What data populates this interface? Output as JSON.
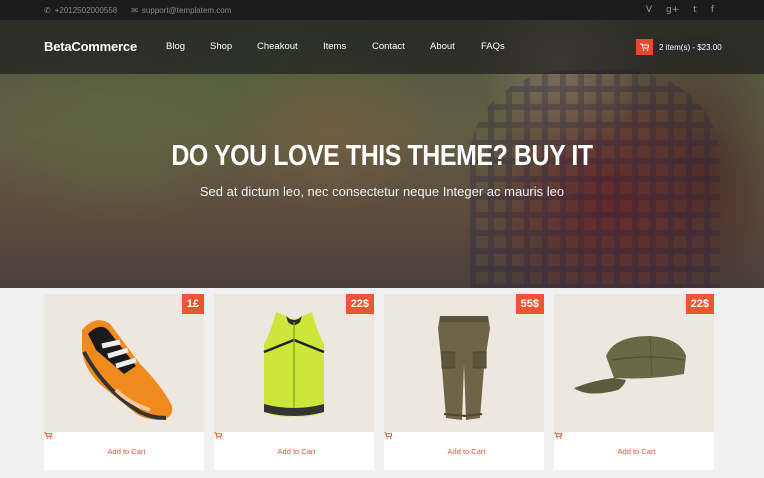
{
  "topbar": {
    "phone": "+2012502000558",
    "email": "support@templatem.com",
    "phone_icon": "phone-icon",
    "email_icon": "envelope-icon",
    "social": [
      {
        "icon": "vine-icon",
        "glyph": "V"
      },
      {
        "icon": "google-plus-icon",
        "glyph": "g+"
      },
      {
        "icon": "twitter-icon",
        "glyph": "t"
      },
      {
        "icon": "facebook-icon",
        "glyph": "f"
      }
    ]
  },
  "navbar": {
    "brand": "BetaCommerce",
    "menu": [
      "Blog",
      "Shop",
      "Cheakout",
      "Items",
      "Contact",
      "About",
      "FAQs"
    ],
    "cart_label": "2 item(s) - $23.00",
    "cart_icon": "shopping-cart-icon"
  },
  "hero": {
    "title": "DO YOU LOVE THIS THEME? BUY IT",
    "subtitle": "Sed at dictum leo, nec consectetur neque Integer ac mauris leo"
  },
  "products": [
    {
      "name": "cycling-shoe",
      "price": "1£",
      "add_label": "Add to Cart"
    },
    {
      "name": "cycling-vest",
      "price": "22$",
      "add_label": "Add to Cart"
    },
    {
      "name": "cargo-pants",
      "price": "55$",
      "add_label": "Add to Cart"
    },
    {
      "name": "army-cap",
      "price": "22$",
      "add_label": "Add to Cart"
    }
  ],
  "colors": {
    "accent": "#ee5533",
    "topbar_bg": "#1b1b1b",
    "product_bg": "#ede7df"
  }
}
